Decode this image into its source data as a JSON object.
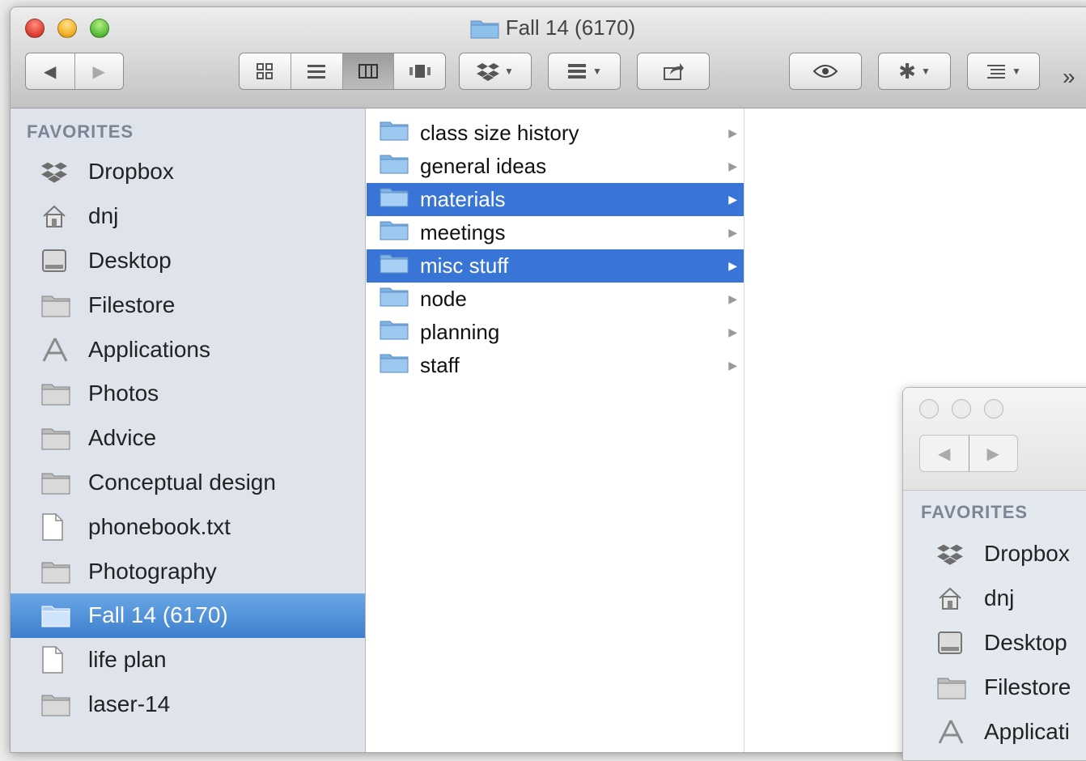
{
  "window": {
    "title": "Fall 14 (6170)",
    "toolbar": {
      "back": "◀",
      "forward": "▶",
      "more": "»"
    }
  },
  "sidebar": {
    "heading": "FAVORITES",
    "items": [
      {
        "label": "Dropbox",
        "icon": "dropbox-icon"
      },
      {
        "label": "dnj",
        "icon": "home-icon"
      },
      {
        "label": "Desktop",
        "icon": "desktop-icon"
      },
      {
        "label": "Filestore",
        "icon": "folder-icon"
      },
      {
        "label": "Applications",
        "icon": "applications-icon"
      },
      {
        "label": "Photos",
        "icon": "folder-icon"
      },
      {
        "label": "Advice",
        "icon": "folder-icon"
      },
      {
        "label": "Conceptual design",
        "icon": "folder-icon"
      },
      {
        "label": "phonebook.txt",
        "icon": "document-icon"
      },
      {
        "label": "Photography",
        "icon": "folder-icon"
      },
      {
        "label": "Fall 14 (6170)",
        "icon": "folder-icon",
        "selected": true
      },
      {
        "label": "life plan",
        "icon": "document-icon"
      },
      {
        "label": "laser-14",
        "icon": "folder-icon"
      }
    ]
  },
  "column": {
    "items": [
      {
        "label": "class size history",
        "selected": false
      },
      {
        "label": "general ideas",
        "selected": false
      },
      {
        "label": "materials",
        "selected": true
      },
      {
        "label": "meetings",
        "selected": false
      },
      {
        "label": "misc stuff",
        "selected": true
      },
      {
        "label": "node",
        "selected": false
      },
      {
        "label": "planning",
        "selected": false
      },
      {
        "label": "staff",
        "selected": false
      }
    ]
  },
  "second_window": {
    "heading": "FAVORITES",
    "items": [
      {
        "label": "Dropbox",
        "icon": "dropbox-icon"
      },
      {
        "label": "dnj",
        "icon": "home-icon"
      },
      {
        "label": "Desktop",
        "icon": "desktop-icon"
      },
      {
        "label": "Filestore",
        "icon": "folder-icon"
      },
      {
        "label": "Applicati",
        "icon": "applications-icon"
      }
    ]
  },
  "colors": {
    "selection_blue": "#3875d7",
    "sidebar_bg": "#dfe4ec",
    "sidebar_selected": "#4d8fd8"
  }
}
